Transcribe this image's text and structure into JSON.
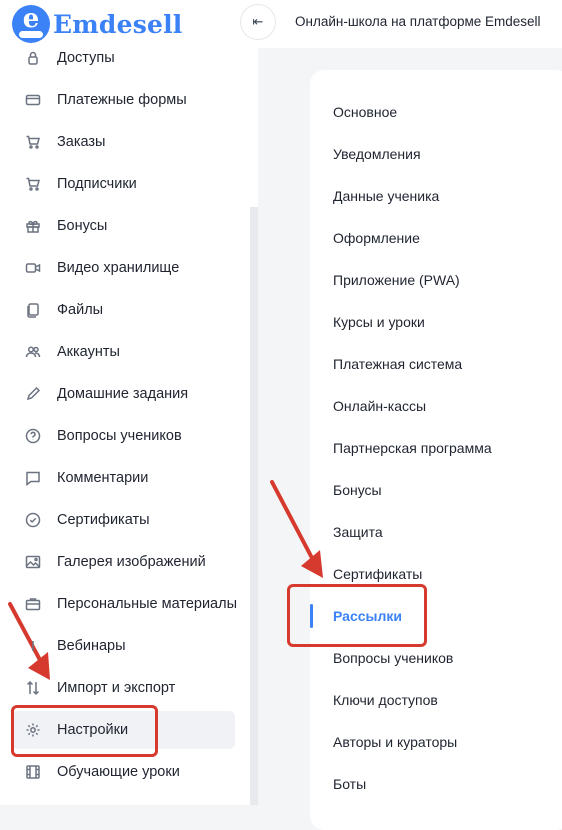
{
  "brand": {
    "logo_letter": "e",
    "name": "Emdesell"
  },
  "topbar": {
    "collapse_icon": "⇤",
    "title": "Онлайн-школа на платформе Emdesell"
  },
  "sidebar": {
    "items": [
      {
        "label": "Доступы",
        "icon": "lock-icon"
      },
      {
        "label": "Платежные формы",
        "icon": "credit-card-icon"
      },
      {
        "label": "Заказы",
        "icon": "cart-icon"
      },
      {
        "label": "Подписчики",
        "icon": "cart-icon"
      },
      {
        "label": "Бонусы",
        "icon": "gift-icon"
      },
      {
        "label": "Видео хранилище",
        "icon": "video-icon"
      },
      {
        "label": "Файлы",
        "icon": "file-icon"
      },
      {
        "label": "Аккаунты",
        "icon": "users-icon"
      },
      {
        "label": "Домашние задания",
        "icon": "pencil-icon"
      },
      {
        "label": "Вопросы учеников",
        "icon": "question-icon"
      },
      {
        "label": "Комментарии",
        "icon": "comment-icon"
      },
      {
        "label": "Сертификаты",
        "icon": "check-circle-icon"
      },
      {
        "label": "Галерея изображений",
        "icon": "image-icon"
      },
      {
        "label": "Персональные материалы",
        "icon": "briefcase-icon"
      },
      {
        "label": "Вебинары",
        "icon": "webinar-icon"
      },
      {
        "label": "Импорт и экспорт",
        "icon": "import-export-icon"
      },
      {
        "label": "Настройки",
        "icon": "gear-icon",
        "active": true
      },
      {
        "label": "Обучающие уроки",
        "icon": "film-icon"
      }
    ]
  },
  "settings_menu": {
    "items": [
      {
        "label": "Основное"
      },
      {
        "label": "Уведомления"
      },
      {
        "label": "Данные ученика"
      },
      {
        "label": "Оформление"
      },
      {
        "label": "Приложение (PWA)"
      },
      {
        "label": "Курсы и уроки"
      },
      {
        "label": "Платежная система"
      },
      {
        "label": "Онлайн-кассы"
      },
      {
        "label": "Партнерская программа"
      },
      {
        "label": "Бонусы"
      },
      {
        "label": "Защита"
      },
      {
        "label": "Сертификаты"
      },
      {
        "label": "Рассылки",
        "active": true
      },
      {
        "label": "Вопросы учеников"
      },
      {
        "label": "Ключи доступов"
      },
      {
        "label": "Авторы и кураторы"
      },
      {
        "label": "Боты"
      }
    ]
  },
  "colors": {
    "accent": "#3b82f6",
    "annotation_red": "#d63a2e",
    "active_bg": "#f1f2f5"
  }
}
